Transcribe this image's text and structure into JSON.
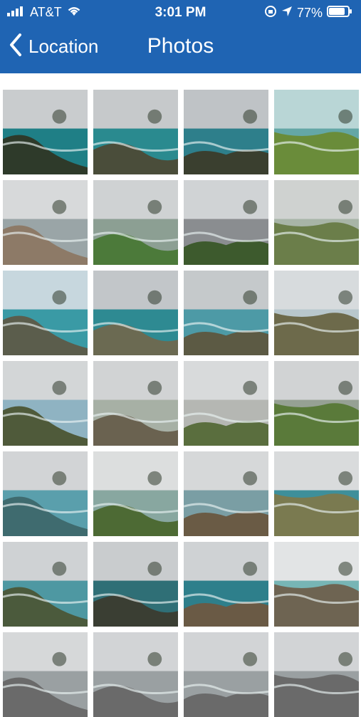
{
  "status": {
    "carrier": "AT&T",
    "time": "3:01 PM",
    "battery": "77%"
  },
  "nav": {
    "back_label": "Location",
    "title": "Photos"
  },
  "photos": [
    {
      "sky": "#c9ccce",
      "sea": "#1f7f86",
      "land": "#2e3a2a"
    },
    {
      "sky": "#c6c9cb",
      "sea": "#2a8a8f",
      "land": "#4a4d3a"
    },
    {
      "sky": "#bfc3c6",
      "sea": "#2e7f8b",
      "land": "#3a3f2f"
    },
    {
      "sky": "#b9d6d6",
      "sea": "#64a7a6",
      "land": "#6a8c3a"
    },
    {
      "sky": "#d7d9da",
      "sea": "#9aa5a7",
      "land": "#8d7a67"
    },
    {
      "sky": "#cfd2d3",
      "sea": "#8c9f93",
      "land": "#4c7a3a"
    },
    {
      "sky": "#d0d3d5",
      "sea": "#8a8d90",
      "land": "#3d5a2d"
    },
    {
      "sky": "#cfd2d0",
      "sea": "#a8b5a7",
      "land": "#6b7e4a"
    },
    {
      "sky": "#c7d7de",
      "sea": "#3a9aa5",
      "land": "#5b5d4c"
    },
    {
      "sky": "#c2c6c9",
      "sea": "#2e8a92",
      "land": "#6b6a52"
    },
    {
      "sky": "#c5c9cb",
      "sea": "#4d9aa6",
      "land": "#5c5a44"
    },
    {
      "sky": "#d7dbdd",
      "sea": "#b8c7cc",
      "land": "#6d6a4b"
    },
    {
      "sky": "#d3d6d7",
      "sea": "#8fb3c2",
      "land": "#4f5a3a"
    },
    {
      "sky": "#d1d3d4",
      "sea": "#a7b0a5",
      "land": "#6a6250"
    },
    {
      "sky": "#d8dadb",
      "sea": "#b5b7b3",
      "land": "#5a6e3e"
    },
    {
      "sky": "#d1d3d4",
      "sea": "#96a194",
      "land": "#5a7a3a"
    },
    {
      "sky": "#d2d4d6",
      "sea": "#5a9fac",
      "land": "#3f6b6f"
    },
    {
      "sky": "#dcdede",
      "sea": "#88a7a0",
      "land": "#4d6a34"
    },
    {
      "sky": "#d6d8d9",
      "sea": "#7a9ea4",
      "land": "#6a5b45"
    },
    {
      "sky": "#d9dbdc",
      "sea": "#3e8f9a",
      "land": "#7a7a50"
    },
    {
      "sky": "#cfd2d4",
      "sea": "#4e98a2",
      "land": "#4b5a3c"
    },
    {
      "sky": "#c9ccce",
      "sea": "#2f6f76",
      "land": "#3a3e33"
    },
    {
      "sky": "#cfd2d4",
      "sea": "#2e7f8b",
      "land": "#6a5a45"
    },
    {
      "sky": "#e2e4e5",
      "sea": "#77b5b5",
      "land": "#6e6452"
    },
    {
      "sky": "#d6d8d9",
      "sea": "#9aa0a2",
      "land": "#6a6a6a"
    },
    {
      "sky": "#d2d4d6",
      "sea": "#9aa0a2",
      "land": "#6a6a6a"
    },
    {
      "sky": "#d2d4d6",
      "sea": "#9aa0a2",
      "land": "#6a6a6a"
    },
    {
      "sky": "#d2d4d6",
      "sea": "#9aa0a2",
      "land": "#6a6a6a"
    }
  ]
}
